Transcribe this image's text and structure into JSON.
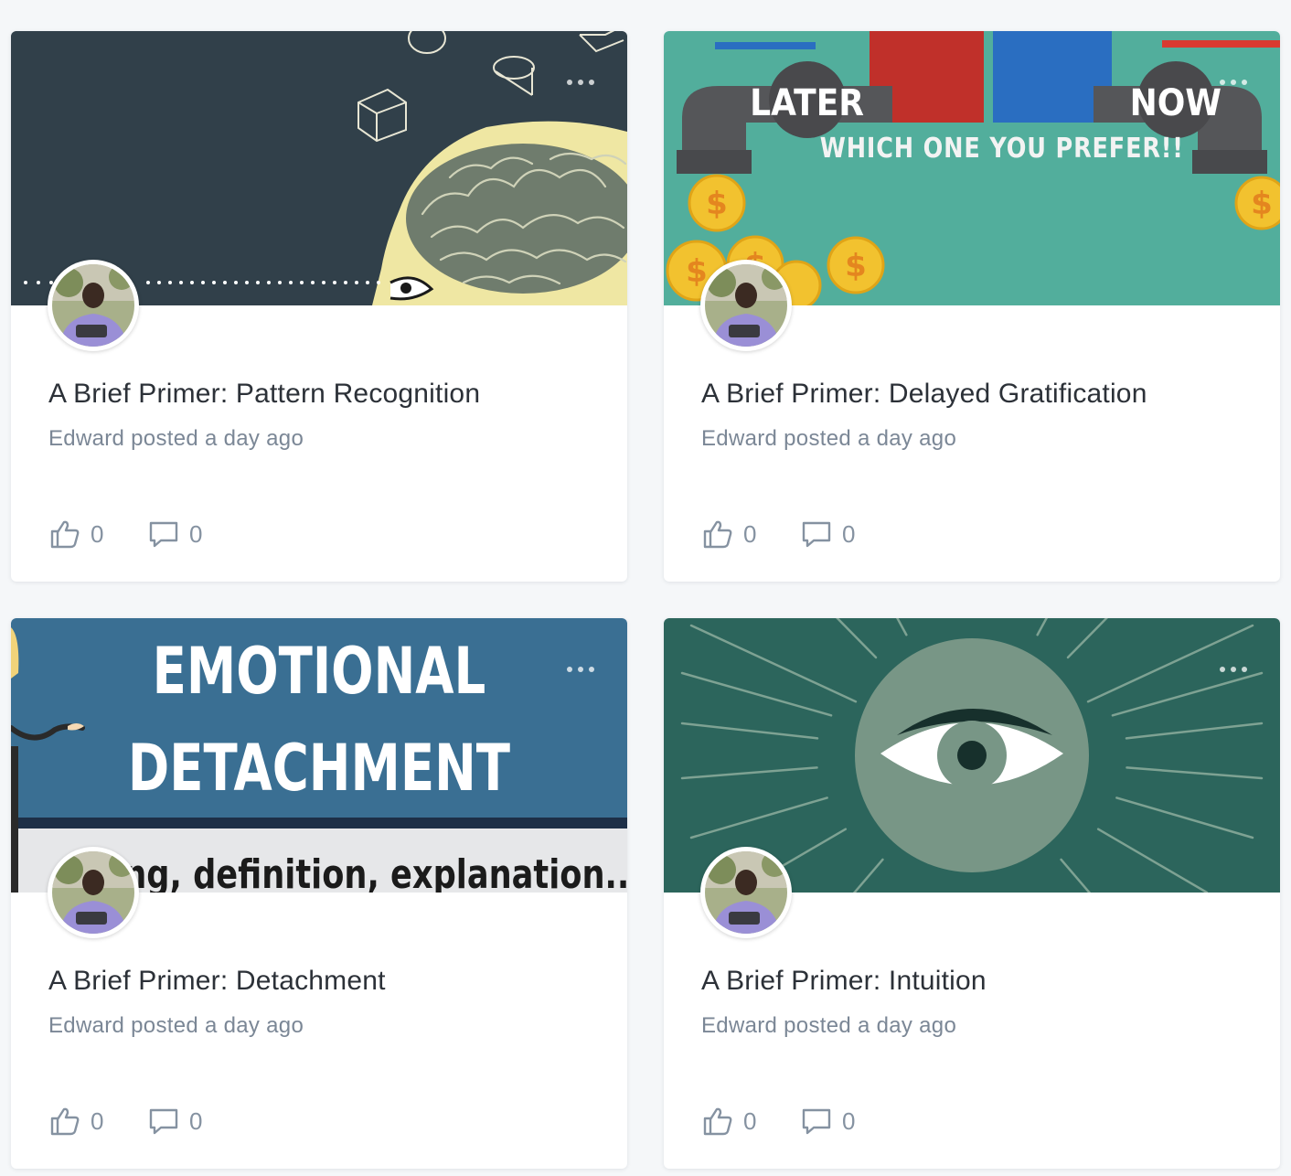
{
  "posts": [
    {
      "title": "A Brief Primer: Pattern Recognition",
      "author": "Edward",
      "meta": "Edward posted a day ago",
      "likes": "0",
      "comments": "0",
      "cover": "brain-pattern-illustration"
    },
    {
      "title": "A Brief Primer: Delayed Gratification",
      "author": "Edward",
      "meta": "Edward posted a day ago",
      "likes": "0",
      "comments": "0",
      "cover": "later-now-pipes-illustration",
      "cover_text": {
        "left": "LATER",
        "right": "NOW",
        "caption": "WHICH ONE YOU PREFER!!"
      }
    },
    {
      "title": "A Brief Primer: Detachment",
      "author": "Edward",
      "meta": "Edward posted a day ago",
      "likes": "0",
      "comments": "0",
      "cover": "emotional-detachment-banner",
      "cover_text": {
        "line1": "EMOTIONAL",
        "line2": "DETACHMENT",
        "subtitle": "aning, definition, explanation..."
      }
    },
    {
      "title": "A Brief Primer: Intuition",
      "author": "Edward",
      "meta": "Edward posted a day ago",
      "likes": "0",
      "comments": "0",
      "cover": "eye-sunburst-illustration"
    }
  ],
  "colors": {
    "page_bg": "#f5f7f9",
    "title": "#2c3138",
    "meta": "#7b8796",
    "action": "#8592a1"
  },
  "icons": {
    "more": "ellipsis-icon",
    "like": "thumbs-up-icon",
    "comment": "comment-bubble-icon"
  }
}
